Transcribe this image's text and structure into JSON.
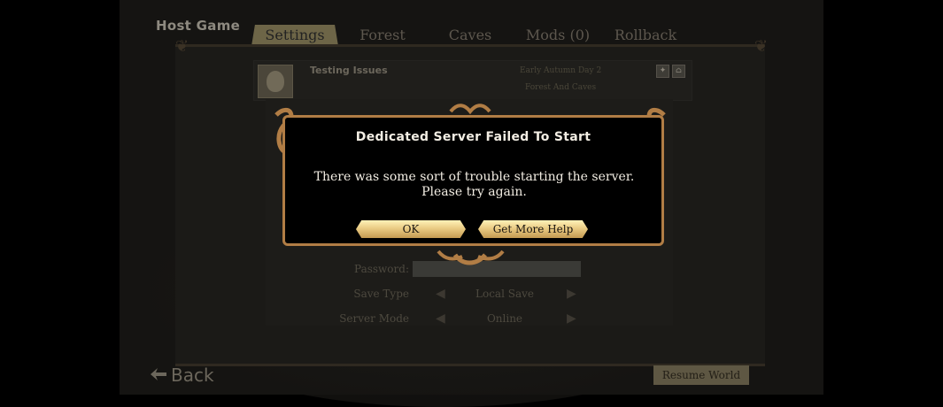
{
  "page": {
    "title": "Host Game"
  },
  "tabs": [
    {
      "label": "Settings",
      "active": true
    },
    {
      "label": "Forest",
      "active": false
    },
    {
      "label": "Caves",
      "active": false
    },
    {
      "label": "Mods (0)",
      "active": false
    },
    {
      "label": "Rollback",
      "active": false
    }
  ],
  "server": {
    "name": "Testing Issues",
    "day": "Early Autumn Day 2",
    "world": "Forest And Caves"
  },
  "settings": [
    {
      "label": "Password:",
      "value": ""
    },
    {
      "label": "Save Type",
      "value": "Local Save"
    },
    {
      "label": "Server Mode",
      "value": "Online"
    }
  ],
  "footer": {
    "back_label": "Back",
    "resume_label": "Resume World"
  },
  "dialog": {
    "title": "Dedicated Server Failed To Start",
    "message": "There was some sort of trouble starting the server. Please try again.",
    "ok_label": "OK",
    "help_label": "Get More Help"
  },
  "colors": {
    "dialog_border": "#b17d45",
    "button_gold": "#e8c981",
    "background": "#151412"
  },
  "icons": {
    "back": "back-arrow-icon",
    "player": "player-avatar-icon"
  }
}
